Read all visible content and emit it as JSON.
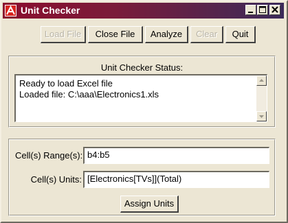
{
  "window": {
    "title": "Unit Checker",
    "app_icon": "red-logo-icon",
    "controls": [
      "minimize-icon",
      "maximize-icon",
      "close-icon"
    ]
  },
  "toolbar": {
    "load_file": "Load File",
    "close_file": "Close File",
    "analyze": "Analyze",
    "clear": "Clear",
    "quit": "Quit"
  },
  "status": {
    "label": "Unit Checker Status:",
    "lines": [
      "Ready to load Excel file",
      "Loaded file: C:\\aaa\\Electronics1.xls"
    ]
  },
  "form": {
    "range_label": "Cell(s) Range(s):",
    "range_value": "b4:b5",
    "units_label": "Cell(s) Units:",
    "units_value": "[Electronics[TVs]](Total)",
    "assign_button": "Assign Units"
  },
  "colors": {
    "titlebar_start": "#8a0d2e",
    "titlebar_end": "#3b2a5a",
    "window_bg": "#ece6d4",
    "disabled_text": "#b9b4a6"
  }
}
